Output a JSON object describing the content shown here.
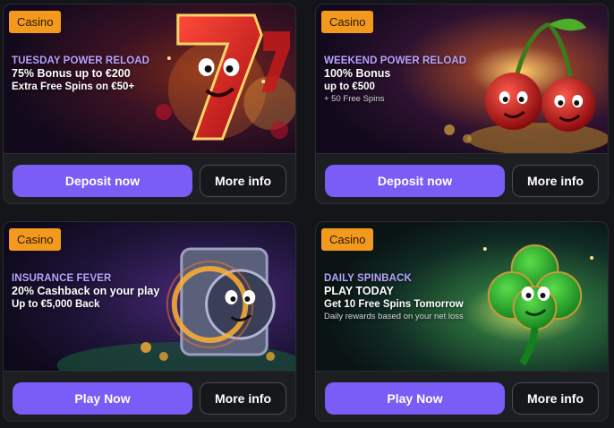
{
  "colors": {
    "page_bg": "#141518",
    "card_bg": "#1d1e22",
    "badge_bg": "#f39a1e",
    "primary_button": "#7a5cf6",
    "eyebrow_text": "#b9a3ff"
  },
  "promos": [
    {
      "badge": "Casino",
      "eyebrow": "TUESDAY POWER RELOAD",
      "headline": "75% Bonus up to €200",
      "sub": "Extra Free Spins on €50+",
      "fine": "",
      "primary_label": "Deposit now",
      "secondary_label": "More info",
      "art_icon": "lucky-seven-icon"
    },
    {
      "badge": "Casino",
      "eyebrow": "WEEKEND POWER RELOAD",
      "headline": "100% Bonus",
      "sub": "up to €500",
      "fine": "+ 50 Free Spins",
      "primary_label": "Deposit now",
      "secondary_label": "More info",
      "art_icon": "cherries-icon"
    },
    {
      "badge": "Casino",
      "eyebrow": "INSURANCE FEVER",
      "headline": "20% Cashback on your play",
      "sub": "Up to €5,000 Back",
      "fine": "",
      "primary_label": "Play Now",
      "secondary_label": "More info",
      "art_icon": "vault-icon"
    },
    {
      "badge": "Casino",
      "eyebrow": "DAILY SPINBACK",
      "headline": "PLAY TODAY",
      "sub": "Get 10 Free Spins Tomorrow",
      "fine": "Daily rewards based on your net loss",
      "primary_label": "Play Now",
      "secondary_label": "More info",
      "art_icon": "clover-icon"
    }
  ]
}
